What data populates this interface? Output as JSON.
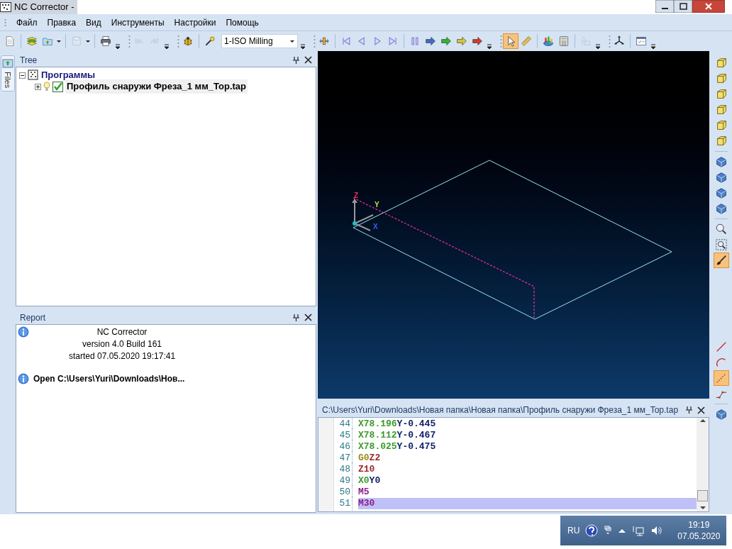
{
  "window": {
    "title": "NC Corrector -"
  },
  "menu": [
    "Файл",
    "Правка",
    "Вид",
    "Инструменты",
    "Настройки",
    "Помощь"
  ],
  "toolbar": [
    {
      "kind": "new",
      "disabled": false
    },
    {
      "kind": "sep"
    },
    {
      "kind": "layers",
      "disabled": false
    },
    {
      "kind": "open",
      "disabled": false
    },
    {
      "kind": "caret"
    },
    {
      "kind": "sep"
    },
    {
      "kind": "save",
      "disabled": true
    },
    {
      "kind": "caret"
    },
    {
      "kind": "sep"
    },
    {
      "kind": "print",
      "disabled": false
    },
    {
      "kind": "overflow"
    },
    {
      "kind": "grip"
    },
    {
      "kind": "undo",
      "disabled": true
    },
    {
      "kind": "redo",
      "disabled": true
    },
    {
      "kind": "overflow"
    },
    {
      "kind": "grip"
    },
    {
      "kind": "bug",
      "disabled": false
    },
    {
      "kind": "sep"
    },
    {
      "kind": "wand",
      "disabled": false
    },
    {
      "kind": "combo",
      "value": "1-ISO Milling"
    },
    {
      "kind": "overflow"
    },
    {
      "kind": "grip"
    },
    {
      "kind": "slider",
      "disabled": false
    },
    {
      "kind": "sep"
    },
    {
      "kind": "first",
      "disabled": false
    },
    {
      "kind": "prev",
      "disabled": false
    },
    {
      "kind": "next",
      "disabled": false
    },
    {
      "kind": "last",
      "disabled": false
    },
    {
      "kind": "sep"
    },
    {
      "kind": "pause",
      "disabled": false
    },
    {
      "kind": "arrow",
      "color": "#3b6fc8"
    },
    {
      "kind": "arrow",
      "color": "#2fb52f"
    },
    {
      "kind": "arrow",
      "color": "#d6c63a"
    },
    {
      "kind": "arrow",
      "color": "#d23a2a"
    },
    {
      "kind": "overflow"
    },
    {
      "kind": "grip"
    },
    {
      "kind": "pointer",
      "selected": true
    },
    {
      "kind": "ruler",
      "selected": false
    },
    {
      "kind": "sep"
    },
    {
      "kind": "chart",
      "disabled": false
    },
    {
      "kind": "calc",
      "disabled": false
    },
    {
      "kind": "sep"
    },
    {
      "kind": "shapes",
      "disabled": true
    },
    {
      "kind": "overflow"
    },
    {
      "kind": "grip"
    },
    {
      "kind": "axes",
      "disabled": false
    },
    {
      "kind": "sep"
    },
    {
      "kind": "window",
      "disabled": false
    },
    {
      "kind": "overflow"
    }
  ],
  "side_tab": {
    "label": "Files"
  },
  "tree": {
    "title": "Tree",
    "items": [
      {
        "label": "Программы",
        "expanded": true,
        "children": [
          {
            "label": "Профиль снаружи Фреза_1 мм_Top.tap",
            "expanded": false,
            "checked": true
          }
        ]
      }
    ]
  },
  "report": {
    "title": "Report",
    "entries": [
      {
        "lines": [
          "NC Corrector",
          "version 4.0 Build 161",
          "started 07.05.2020 19:17:41"
        ],
        "bold": false
      },
      {
        "lines": [
          "Open C:\\Users\\Yuri\\Downloads\\Нов..."
        ],
        "bold": true
      }
    ]
  },
  "viewport": {
    "axes": [
      "Z",
      "Y",
      "X"
    ]
  },
  "right_toolbar": [
    {
      "kind": "cube",
      "selected": false
    },
    {
      "kind": "cube",
      "selected": false
    },
    {
      "kind": "cube",
      "selected": false
    },
    {
      "kind": "cube",
      "selected": false
    },
    {
      "kind": "cube",
      "selected": false
    },
    {
      "kind": "cube",
      "selected": false
    },
    {
      "kind": "sep"
    },
    {
      "kind": "solid",
      "selected": false
    },
    {
      "kind": "solid",
      "selected": false
    },
    {
      "kind": "solid",
      "selected": false
    },
    {
      "kind": "solid",
      "selected": false
    },
    {
      "kind": "sep"
    },
    {
      "kind": "zoom",
      "selected": false
    },
    {
      "kind": "zoombox",
      "selected": false
    },
    {
      "kind": "brush",
      "selected": true
    },
    {
      "kind": "gap"
    },
    {
      "kind": "line",
      "selected": false
    },
    {
      "kind": "arc",
      "selected": false
    },
    {
      "kind": "dashed",
      "selected": true
    },
    {
      "kind": "path",
      "selected": false
    },
    {
      "kind": "sep"
    },
    {
      "kind": "solid",
      "selected": false
    }
  ],
  "editor": {
    "title": "C:\\Users\\Yuri\\Downloads\\Новая папка\\Новая папка\\Профиль снаружи Фреза_1 мм_Top.tap",
    "lines": [
      {
        "number": "44",
        "selected": false,
        "tokens": [
          {
            "text": "X78.196",
            "kind": "x"
          },
          {
            "text": "Y-0.445",
            "kind": "y"
          }
        ]
      },
      {
        "number": "45",
        "selected": false,
        "tokens": [
          {
            "text": "X78.112",
            "kind": "x"
          },
          {
            "text": "Y-0.467",
            "kind": "y"
          }
        ]
      },
      {
        "number": "46",
        "selected": false,
        "tokens": [
          {
            "text": "X78.025",
            "kind": "x"
          },
          {
            "text": "Y-0.475",
            "kind": "y"
          }
        ]
      },
      {
        "number": "47",
        "selected": false,
        "tokens": [
          {
            "text": "G0",
            "kind": "g"
          },
          {
            "text": "Z2",
            "kind": "z"
          }
        ]
      },
      {
        "number": "48",
        "selected": false,
        "tokens": [
          {
            "text": "Z10",
            "kind": "z"
          }
        ]
      },
      {
        "number": "49",
        "selected": false,
        "tokens": [
          {
            "text": "X0",
            "kind": "x"
          },
          {
            "text": "Y0",
            "kind": "y"
          }
        ]
      },
      {
        "number": "50",
        "selected": false,
        "tokens": [
          {
            "text": "M5",
            "kind": "m"
          }
        ]
      },
      {
        "number": "51",
        "selected": true,
        "tokens": [
          {
            "text": "M30",
            "kind": "m"
          }
        ]
      }
    ]
  },
  "taskbar": {
    "language": "RU",
    "time": "19:19",
    "date": "07.05.2020"
  }
}
